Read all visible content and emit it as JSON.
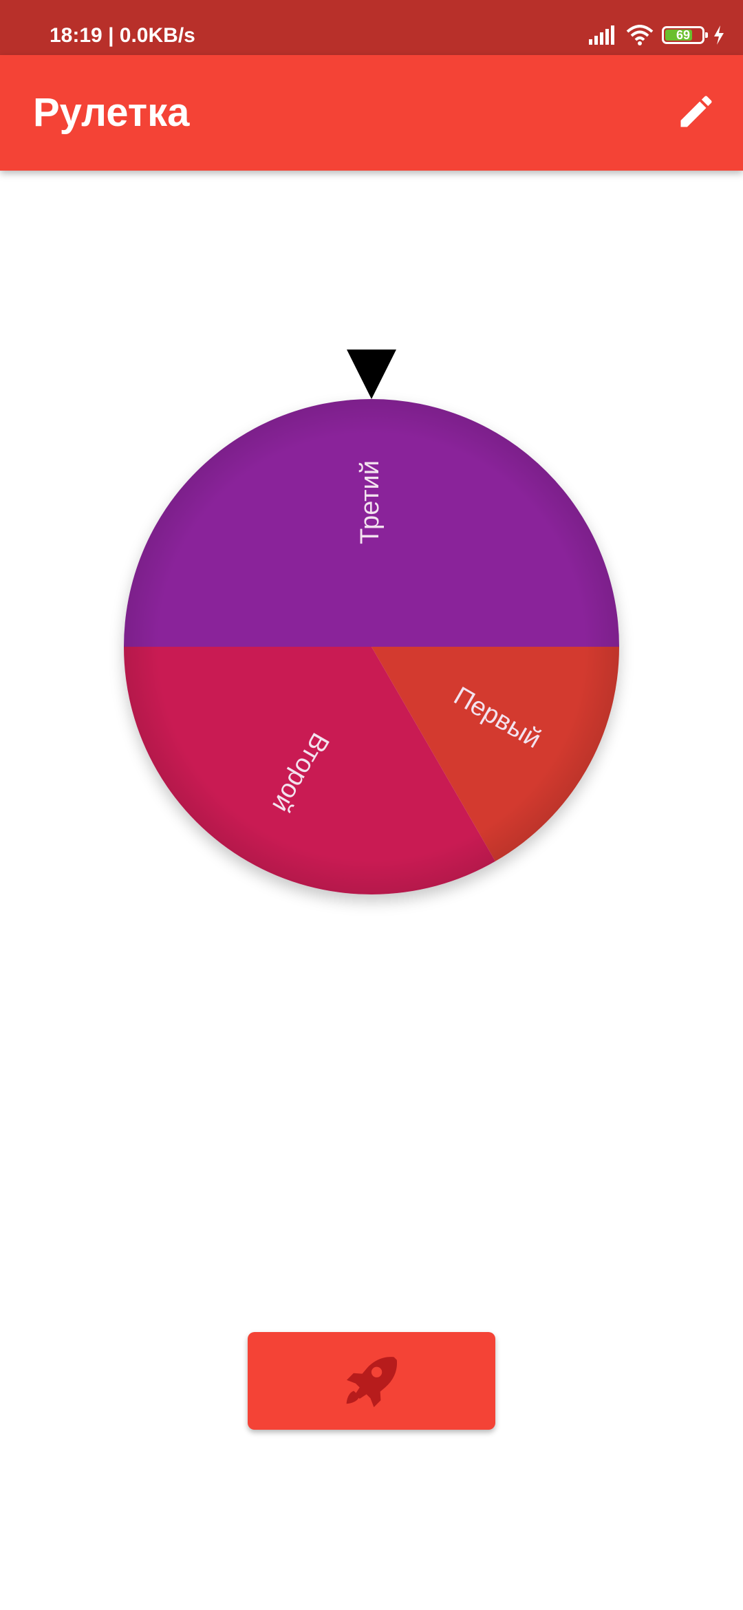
{
  "status_bar": {
    "time": "18:19 | 0.0KB/s",
    "battery_level": "69",
    "icons": [
      "signal-icon",
      "wifi-icon",
      "battery-icon",
      "charging-icon"
    ]
  },
  "app_bar": {
    "title": "Рулетка",
    "action_icon": "edit-pencil-icon"
  },
  "wheel": {
    "pointer_icon": "pointer-triangle-icon",
    "segments": [
      {
        "label": "Первый",
        "color": "#d33a2f"
      },
      {
        "label": "Второй",
        "color": "#c91b53"
      },
      {
        "label": "Третий",
        "color": "#8a239a"
      }
    ]
  },
  "spin_button": {
    "icon": "rocket-icon"
  },
  "colors": {
    "status_bar": "#b8302a",
    "primary": "#f44336",
    "rocket": "#b71c1c"
  }
}
